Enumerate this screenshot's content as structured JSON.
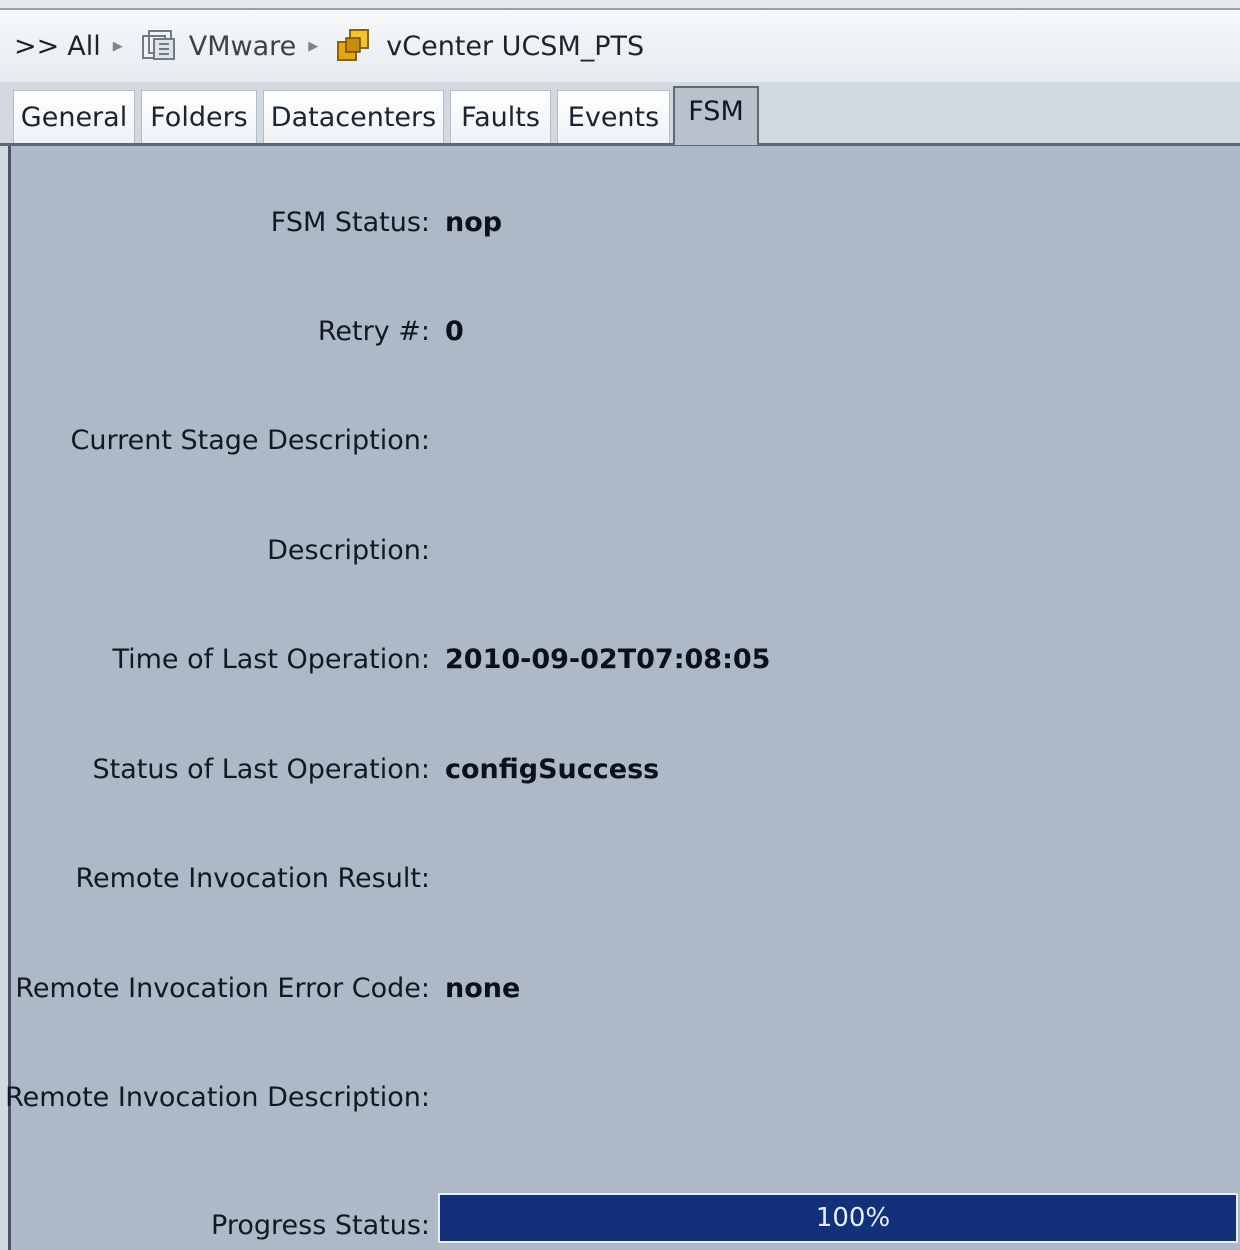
{
  "breadcrumb": {
    "prefix": ">>",
    "items": [
      {
        "label": "All",
        "icon": "none"
      },
      {
        "label": "VMware",
        "icon": "vmware-icon"
      },
      {
        "label": "vCenter UCSM_PTS",
        "icon": "vcenter-icon"
      }
    ]
  },
  "tabs": [
    {
      "label": "General",
      "active": false
    },
    {
      "label": "Folders",
      "active": false
    },
    {
      "label": "Datacenters",
      "active": false
    },
    {
      "label": "Faults",
      "active": false
    },
    {
      "label": "Events",
      "active": false
    },
    {
      "label": "FSM",
      "active": true
    }
  ],
  "fsm": {
    "fsm_status": {
      "label": "FSM Status:",
      "value": "nop"
    },
    "retry": {
      "label": "Retry #:",
      "value": "0"
    },
    "current_stage": {
      "label": "Current Stage Description:",
      "value": ""
    },
    "description": {
      "label": "Description:",
      "value": ""
    },
    "time_last_op": {
      "label": "Time of Last Operation:",
      "value": "2010-09-02T07:08:05"
    },
    "status_last_op": {
      "label": "Status of Last Operation:",
      "value": "configSuccess"
    },
    "remote_result": {
      "label": "Remote Invocation Result:",
      "value": ""
    },
    "remote_error": {
      "label": "Remote Invocation Error Code:",
      "value": "none"
    },
    "remote_desc": {
      "label": "Remote Invocation Description:",
      "value": ""
    },
    "progress": {
      "label": "Progress Status:",
      "text": "100%",
      "fraction": 1.0
    }
  },
  "colors": {
    "panel_bg": "#adb9c7",
    "progress_fill": "#13307b",
    "active_tab": "#b8c2cd"
  }
}
